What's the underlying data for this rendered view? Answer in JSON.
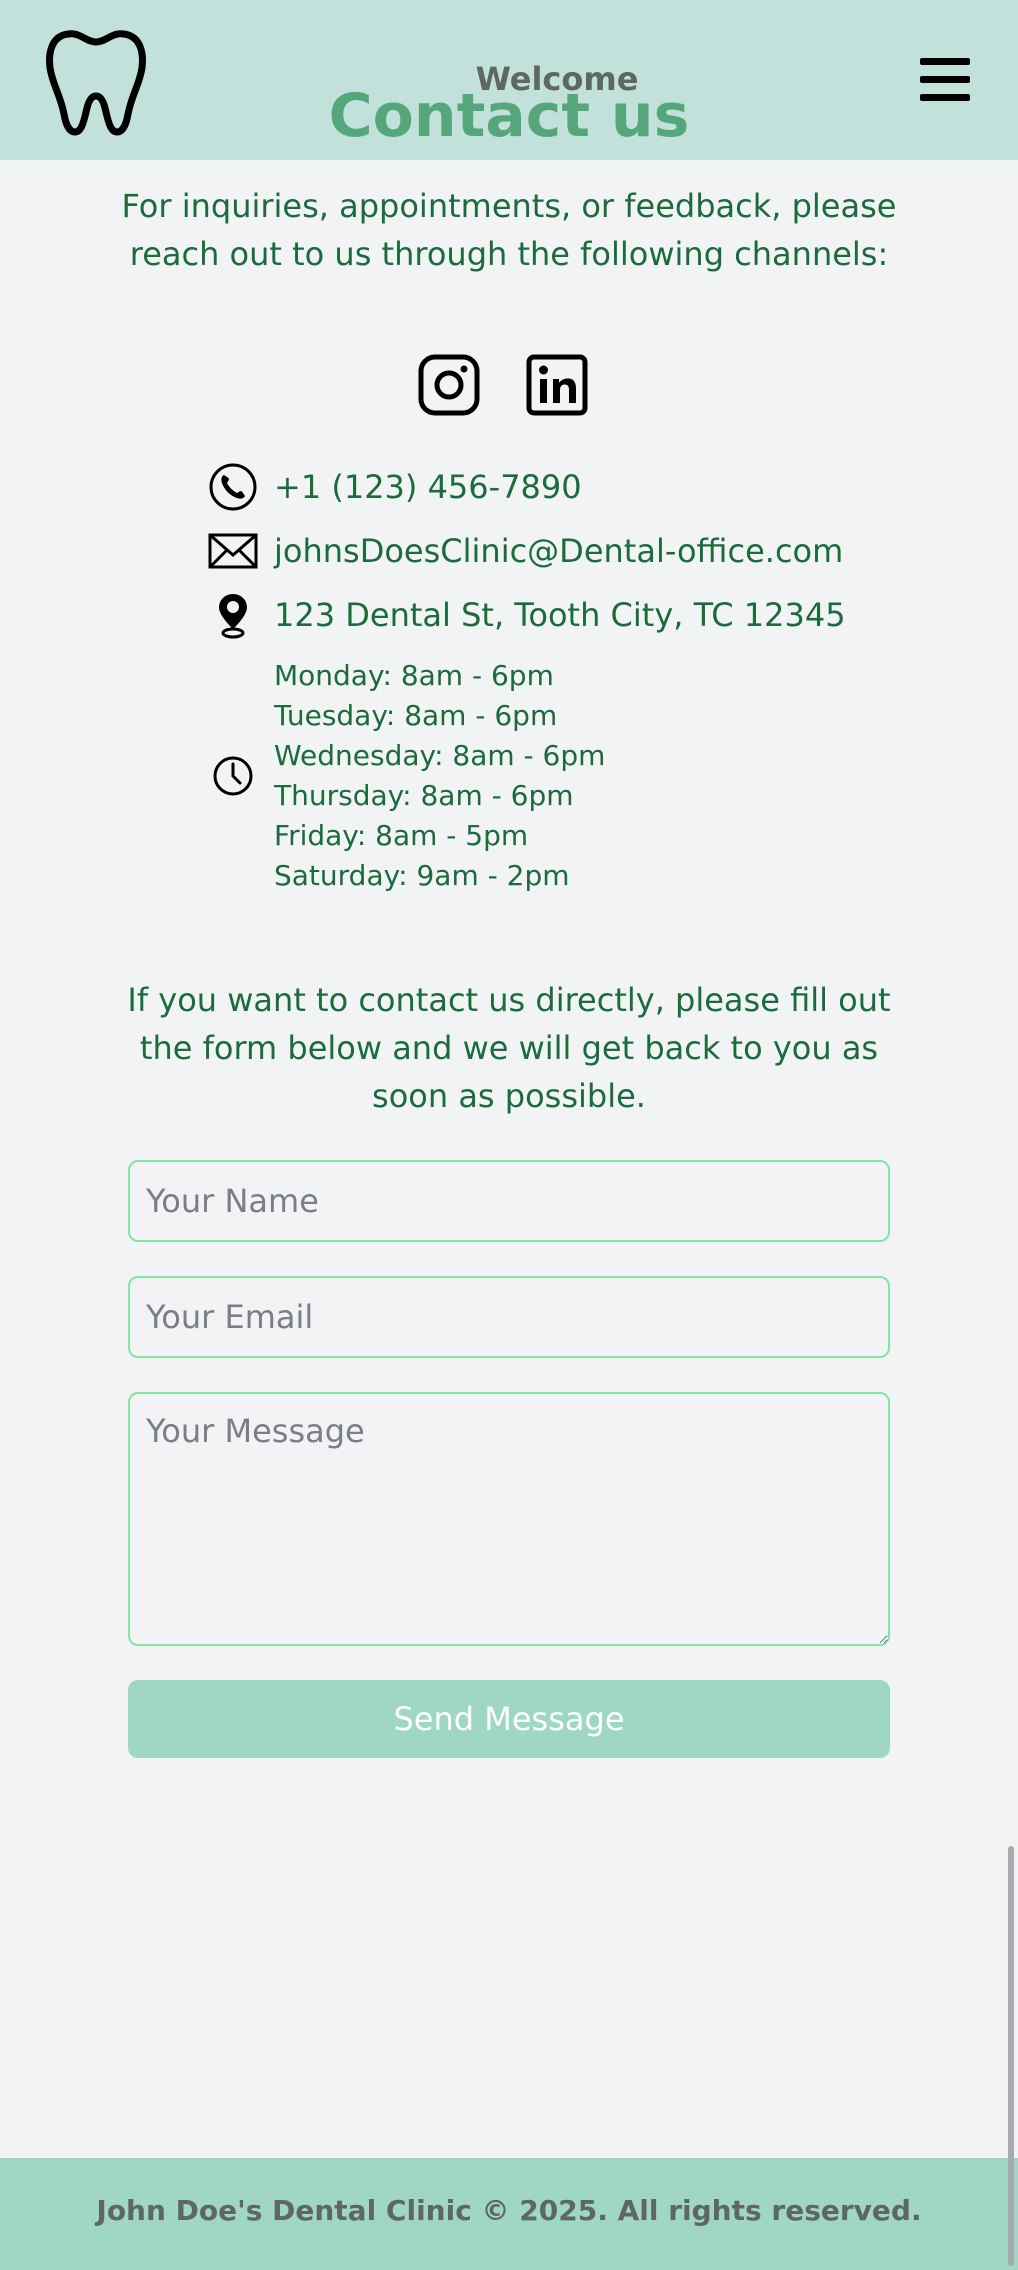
{
  "header": {
    "welcome": "Welcome",
    "title": "Contact us",
    "logo_icon": "tooth-icon",
    "menu_icon": "hamburger-menu-icon"
  },
  "intro": "For inquiries, appointments, or feedback, please reach out to us through the following channels:",
  "social": [
    {
      "name": "instagram",
      "icon": "instagram-icon"
    },
    {
      "name": "linkedin",
      "icon": "linkedin-icon"
    }
  ],
  "contact": {
    "phone": "+1 (123) 456-7890",
    "email": "johnsDoesClinic@Dental-office.com",
    "address": "123 Dental St, Tooth City, TC 12345",
    "hours": [
      "Monday: 8am - 6pm",
      "Tuesday: 8am - 6pm",
      "Wednesday: 8am - 6pm",
      "Thursday: 8am - 6pm",
      "Friday: 8am - 5pm",
      "Saturday: 9am - 2pm"
    ]
  },
  "form": {
    "intro": "If you want to contact us directly, please fill out the form below and we will get back to you as soon as possible.",
    "name_placeholder": "Your Name",
    "email_placeholder": "Your Email",
    "message_placeholder": "Your Message",
    "name_value": "",
    "email_value": "",
    "message_value": "",
    "submit_label": "Send Message"
  },
  "footer": {
    "text": "John Doe's Dental Clinic © 2025. All rights reserved."
  },
  "colors": {
    "header_bg": "#c2e1da",
    "title": "#56a67c",
    "text_green": "#1c6b3c",
    "button_bg": "#a0d6c6",
    "field_border": "#83e4a4",
    "page_bg": "#f2f3f5"
  }
}
